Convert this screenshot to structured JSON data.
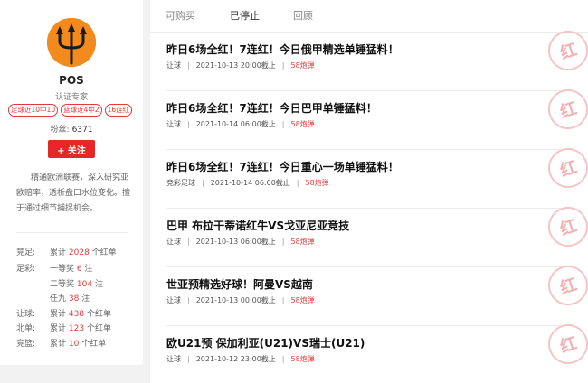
{
  "profile": {
    "name": "POS",
    "role": "认证专家",
    "tags": [
      "足球近10中10",
      "篮球近4中2",
      "16连红"
    ],
    "fans_label": "粉丝:",
    "fans_count": "6371",
    "follow_label": "+ 关注",
    "intro": "精通欧洲联赛，深入研究亚欧赔率，透析盘口水位变化。擅于通过细节捕捉机会。",
    "stats": [
      {
        "label": "竞足:",
        "prefix": "累计",
        "value": "2028",
        "unit": "个红单"
      },
      {
        "label": "足彩:",
        "prefix": "一等奖",
        "value": "6",
        "unit": "注"
      },
      {
        "label": "",
        "prefix": "二等奖",
        "value": "104",
        "unit": "注"
      },
      {
        "label": "",
        "prefix": "任九",
        "value": "38",
        "unit": "注"
      },
      {
        "label": "让球:",
        "prefix": "累计",
        "value": "438",
        "unit": "个红单"
      },
      {
        "label": "北单:",
        "prefix": "累计",
        "value": "123",
        "unit": "个红单"
      },
      {
        "label": "竞篮:",
        "prefix": "累计",
        "value": "10",
        "unit": "个红单"
      }
    ]
  },
  "tabs": [
    "可购买",
    "已停止",
    "回顾"
  ],
  "active_tab": "已停止",
  "items": [
    {
      "title": "昨日6场全红！7连红！今日俄甲精选单锤猛料！",
      "type": "让球",
      "time": "2021-10-13 20:00截止",
      "price": "58炮弹"
    },
    {
      "title": "昨日6场全红！7连红！今日巴甲单锤猛料！",
      "type": "让球",
      "time": "2021-10-14 06:00截止",
      "price": "58炮弹"
    },
    {
      "title": "昨日6场全红！7连红！今日重心一场单锤猛料！",
      "type": "竞彩足球",
      "time": "2021-10-14 06:00截止",
      "price": "58炮弹"
    },
    {
      "title": "巴甲 布拉干蒂诺红牛VS戈亚尼亚竞技",
      "type": "让球",
      "time": "2021-10-13 06:00截止",
      "price": "58炮弹"
    },
    {
      "title": "世亚预精选好球！阿曼VS越南",
      "type": "让球",
      "time": "2021-10-13 00:00截止",
      "price": "58炮弹"
    },
    {
      "title": "欧U21预 保加利亚(U21)VS瑞士(U21)",
      "type": "让球",
      "time": "2021-10-12 23:00截止",
      "price": "58炮弹"
    }
  ],
  "stamp_text": "红"
}
